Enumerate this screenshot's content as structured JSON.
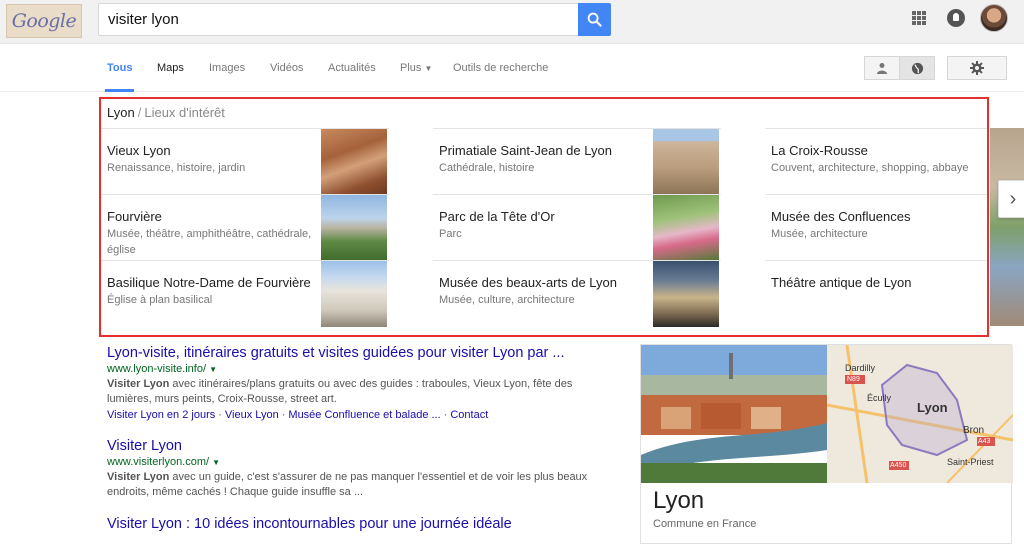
{
  "header": {
    "logo_text": "Google",
    "query": "visiter lyon"
  },
  "tabs": [
    "Tous",
    "Maps",
    "Images",
    "Vidéos",
    "Actualités",
    "Plus",
    "Outils de recherche"
  ],
  "carousel": {
    "breadcrumb_root": "Lyon",
    "breadcrumb_sub": "Lieux d'intérêt",
    "items": [
      {
        "title": "Vieux Lyon",
        "desc": "Renaissance, histoire, jardin"
      },
      {
        "title": "Primatiale Saint-Jean de Lyon",
        "desc": "Cathédrale, histoire"
      },
      {
        "title": "La Croix-Rousse",
        "desc": "Couvent, architecture, shopping, abbaye"
      },
      {
        "title": "Fourvière",
        "desc": "Musée, théâtre, amphithéâtre, cathédrale, église"
      },
      {
        "title": "Parc de la Tête d'Or",
        "desc": "Parc"
      },
      {
        "title": "Musée des Confluences",
        "desc": "Musée, architecture"
      },
      {
        "title": "Basilique Notre-Dame de Fourvière",
        "desc": "Église à plan basilical"
      },
      {
        "title": "Musée des beaux-arts de Lyon",
        "desc": "Musée, culture, architecture"
      },
      {
        "title": "Théâtre antique de Lyon",
        "desc": ""
      }
    ]
  },
  "results": [
    {
      "title": "Lyon-visite, itinéraires gratuits et visites guidées pour visiter Lyon par ...",
      "url": "www.lyon-visite.info/",
      "snippet_bold": "Visiter Lyon",
      "snippet": " avec itinéraires/plans gratuits ou avec des guides : traboules, Vieux Lyon, fête des lumières, murs peints, Croix-Rousse, street art.",
      "links": [
        "Visiter Lyon en 2 jours",
        "Vieux Lyon",
        "Musée Confluence et balade ...",
        "Contact"
      ]
    },
    {
      "title": "Visiter Lyon",
      "url": "www.visiterlyon.com/",
      "snippet_bold": "Visiter Lyon",
      "snippet": " avec un guide, c'est s'assurer de ne pas manquer l'essentiel et de voir les plus beaux endroits, même cachés ! Chaque guide insuffle sa ..."
    },
    {
      "title": "Visiter Lyon : 10 idées incontournables pour une journée idéale"
    }
  ],
  "knowledge_panel": {
    "title": "Lyon",
    "subtitle": "Commune en France",
    "map_labels": [
      "Dardilly",
      "N89",
      "Écully",
      "Lyon",
      "Bron",
      "A43",
      "A450",
      "Saint-Priest"
    ]
  }
}
